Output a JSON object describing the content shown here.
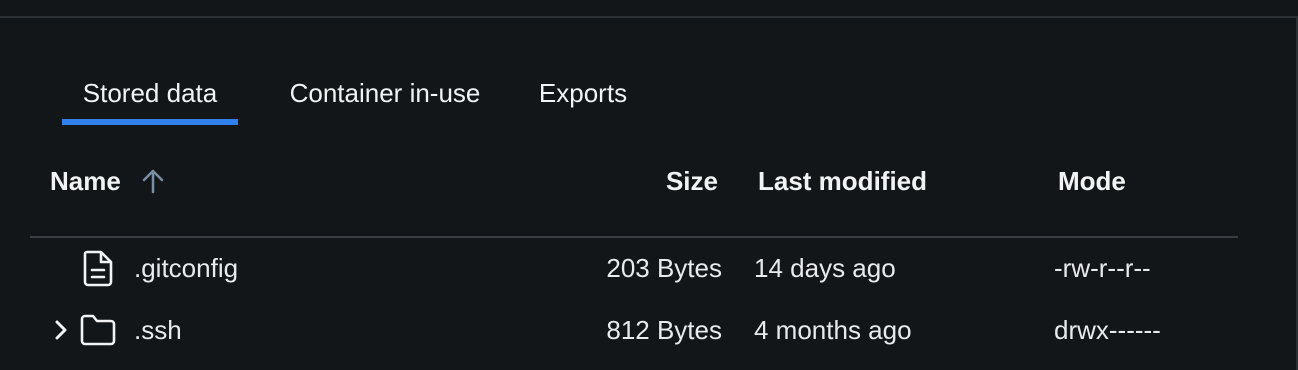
{
  "tabs": [
    {
      "label": "Stored data",
      "active": true
    },
    {
      "label": "Container in-use",
      "active": false
    },
    {
      "label": "Exports",
      "active": false
    }
  ],
  "table": {
    "columns": {
      "name": "Name",
      "size": "Size",
      "modified": "Last modified",
      "mode": "Mode"
    },
    "sort_icon": "arrow-up-icon",
    "rows": [
      {
        "icon": "file-icon",
        "name": ".gitconfig",
        "size": "203 Bytes",
        "modified": "14 days ago",
        "mode": "-rw-r--r--",
        "expandable": false
      },
      {
        "icon": "folder-icon",
        "name": ".ssh",
        "size": "812 Bytes",
        "modified": "4 months ago",
        "mode": "drwx------",
        "expandable": true
      }
    ]
  },
  "colors": {
    "background": "#121619",
    "accent": "#2f80ed",
    "divider": "#3a3f44",
    "sort_icon": "#7a8ea3"
  }
}
